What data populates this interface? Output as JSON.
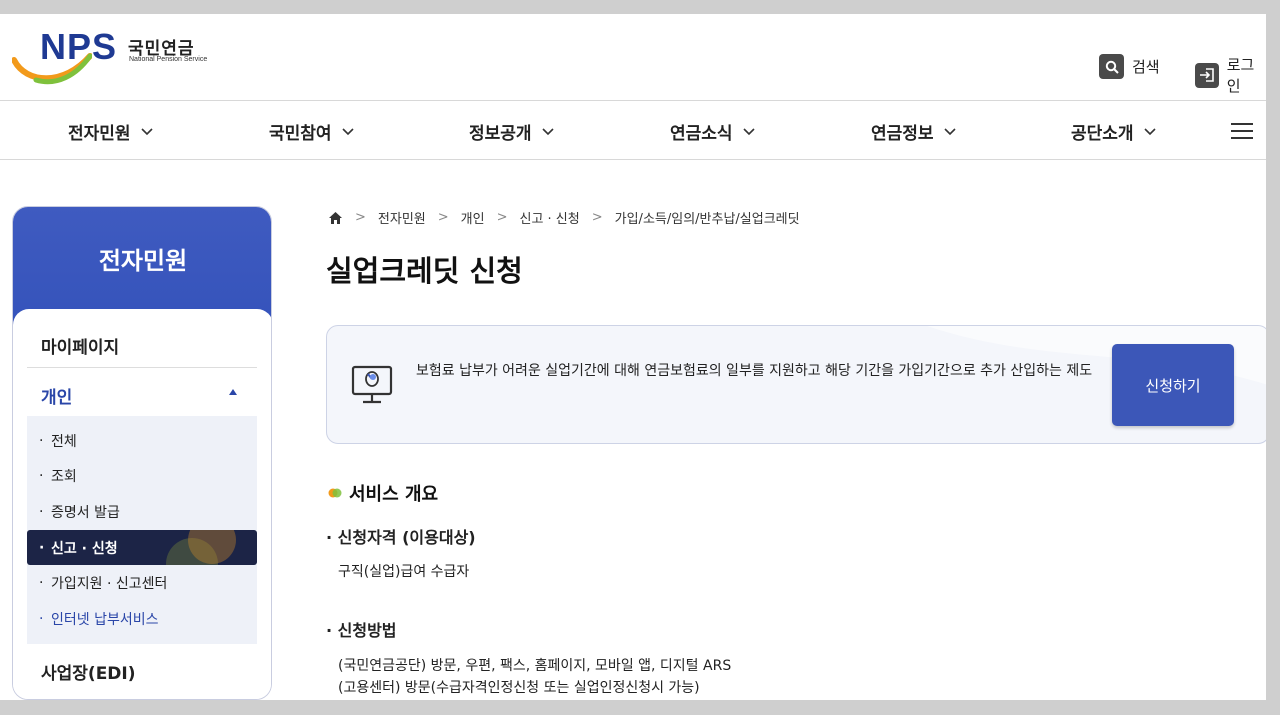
{
  "header": {
    "logo_text": "NPS",
    "logo_korean": "국민연금",
    "logo_english": "National Pension Service",
    "search_label": "검색",
    "login_label": "로그인"
  },
  "gnb": {
    "items": [
      {
        "label": "전자민원"
      },
      {
        "label": "국민참여"
      },
      {
        "label": "정보공개"
      },
      {
        "label": "연금소식"
      },
      {
        "label": "연금정보"
      },
      {
        "label": "공단소개"
      }
    ]
  },
  "lnb": {
    "title": "전자민원",
    "mypage": "마이페이지",
    "personal": "개인",
    "business": "사업장(EDI)",
    "sub_items": [
      {
        "label": "전체"
      },
      {
        "label": "조회"
      },
      {
        "label": "증명서 발급"
      },
      {
        "label": "신고 · 신청"
      },
      {
        "label": "가입지원 · 신고센터"
      },
      {
        "label": "인터넷 납부서비스"
      }
    ],
    "bullet": "·"
  },
  "breadcrumb": {
    "items": [
      "전자민원",
      "개인",
      "신고 · 신청",
      "가입/소득/임의/반추납/실업크레딧"
    ],
    "separator": ">"
  },
  "main": {
    "title": "실업크레딧 신청",
    "info_text": "보험료 납부가 어려운 실업기간에 대해 연금보험료의 일부를 지원하고 해당 기간을 가입기간으로 추가 산입하는 제도",
    "apply_button": "신청하기",
    "section_title": "서비스 개요",
    "eligibility_head": "· 신청자격 (이용대상)",
    "eligibility_text": "구직(실업)급여 수급자",
    "method_head": "· 신청방법",
    "method_line1": "(국민연금공단) 방문, 우편, 팩스, 홈페이지, 모바일 앱, 디지털 ARS",
    "method_line2": "(고용센터) 방문(수급자격인정신청 또는 실업인정신청시 가능)"
  },
  "colors": {
    "brand_blue": "#3c57b8",
    "nav_active": "#1c2446",
    "logo_navy": "#1f3a93"
  }
}
